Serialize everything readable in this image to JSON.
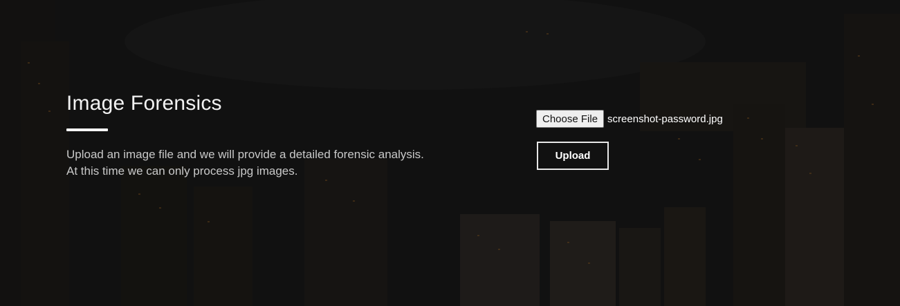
{
  "hero": {
    "title": "Image Forensics",
    "description_line1": "Upload an image file and we will provide a detailed forensic analysis.",
    "description_line2": "At this time we can only process jpg images."
  },
  "upload_form": {
    "choose_file_label": "Choose File",
    "selected_file_name": "screenshot-password.jpg",
    "upload_label": "Upload"
  },
  "colors": {
    "background": "#141414",
    "text_primary": "#f2f2f2",
    "text_secondary": "#c9c9c9",
    "button_border": "#e8e8e8"
  }
}
